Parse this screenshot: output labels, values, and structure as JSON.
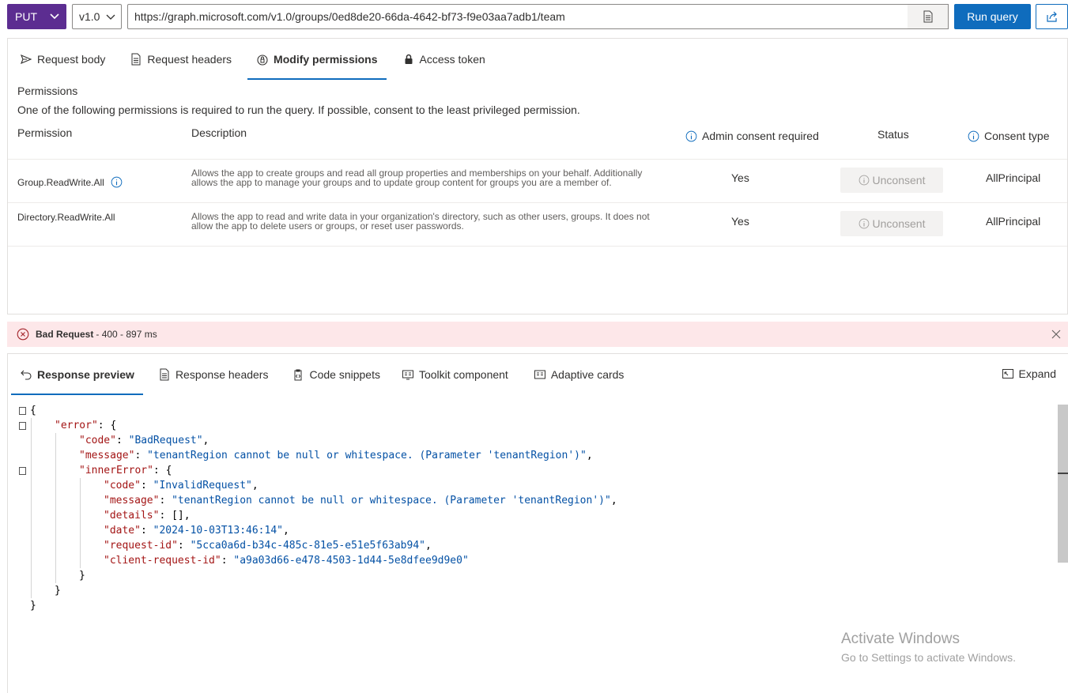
{
  "query": {
    "method": "PUT",
    "version": "v1.0",
    "url": "https://graph.microsoft.com/v1.0/groups/0ed8de20-66da-4642-bf73-f9e03aa7adb1/team",
    "run_label": "Run query"
  },
  "request_tabs": [
    {
      "label": "Request body",
      "icon": "send-icon"
    },
    {
      "label": "Request headers",
      "icon": "document-icon"
    },
    {
      "label": "Modify permissions",
      "icon": "lock-shield-icon"
    },
    {
      "label": "Access token",
      "icon": "lock-icon"
    }
  ],
  "permissions": {
    "title": "Permissions",
    "subtitle": "One of the following permissions is required to run the query. If possible, consent to the least privileged permission.",
    "headers": {
      "permission": "Permission",
      "description": "Description",
      "admin": "Admin consent required",
      "status": "Status",
      "consent": "Consent type"
    },
    "rows": [
      {
        "name": "Group.ReadWrite.All",
        "description": "Allows the app to create groups and read all group properties and memberships on your behalf. Additionally allows the app to manage your groups and to update group content for groups you are a member of.",
        "admin": "Yes",
        "status": "Unconsent",
        "consent": "AllPrincipal"
      },
      {
        "name": "Directory.ReadWrite.All",
        "description": "Allows the app to read and write data in your organization's directory, such as other users, groups. It does not allow the app to delete users or groups, or reset user passwords.",
        "admin": "Yes",
        "status": "Unconsent",
        "consent": "AllPrincipal"
      }
    ]
  },
  "status_bar": {
    "label": "Bad Request",
    "detail": "- 400 - 897 ms",
    "color": "#fde7e9"
  },
  "response_tabs": [
    {
      "label": "Response preview",
      "icon": "undo-arrow-icon"
    },
    {
      "label": "Response headers",
      "icon": "document-icon"
    },
    {
      "label": "Code snippets",
      "icon": "clipboard-code-icon"
    },
    {
      "label": "Toolkit component",
      "icon": "toolkit-icon"
    },
    {
      "label": "Adaptive cards",
      "icon": "card-icon"
    }
  ],
  "expand_label": "Expand",
  "response_json": {
    "open": "{",
    "error_key": "\"error\"",
    "code_key": "\"code\"",
    "code_val": "\"BadRequest\"",
    "message_key": "\"message\"",
    "message_val": "\"tenantRegion cannot be null or whitespace. (Parameter 'tenantRegion')\"",
    "inner_key": "\"innerError\"",
    "inner_code_val": "\"InvalidRequest\"",
    "inner_message_val": "\"tenantRegion cannot be null or whitespace. (Parameter 'tenantRegion')\"",
    "details_key": "\"details\"",
    "details_val": "[]",
    "date_key": "\"date\"",
    "date_val": "\"2024-10-03T13:46:14\"",
    "reqid_key": "\"request-id\"",
    "reqid_val": "\"5cca0a6d-b34c-485c-81e5-e51e5f63ab94\"",
    "clientid_key": "\"client-request-id\"",
    "clientid_val": "\"a9a03d66-e478-4503-1d44-5e8dfee9d9e0\""
  },
  "watermark": {
    "line1": "Activate Windows",
    "line2": "Go to Settings to activate Windows."
  },
  "colors": {
    "method_bg": "#5c2d91",
    "accent": "#0f6cbd",
    "key": "#a31515",
    "string": "#0451a5"
  }
}
